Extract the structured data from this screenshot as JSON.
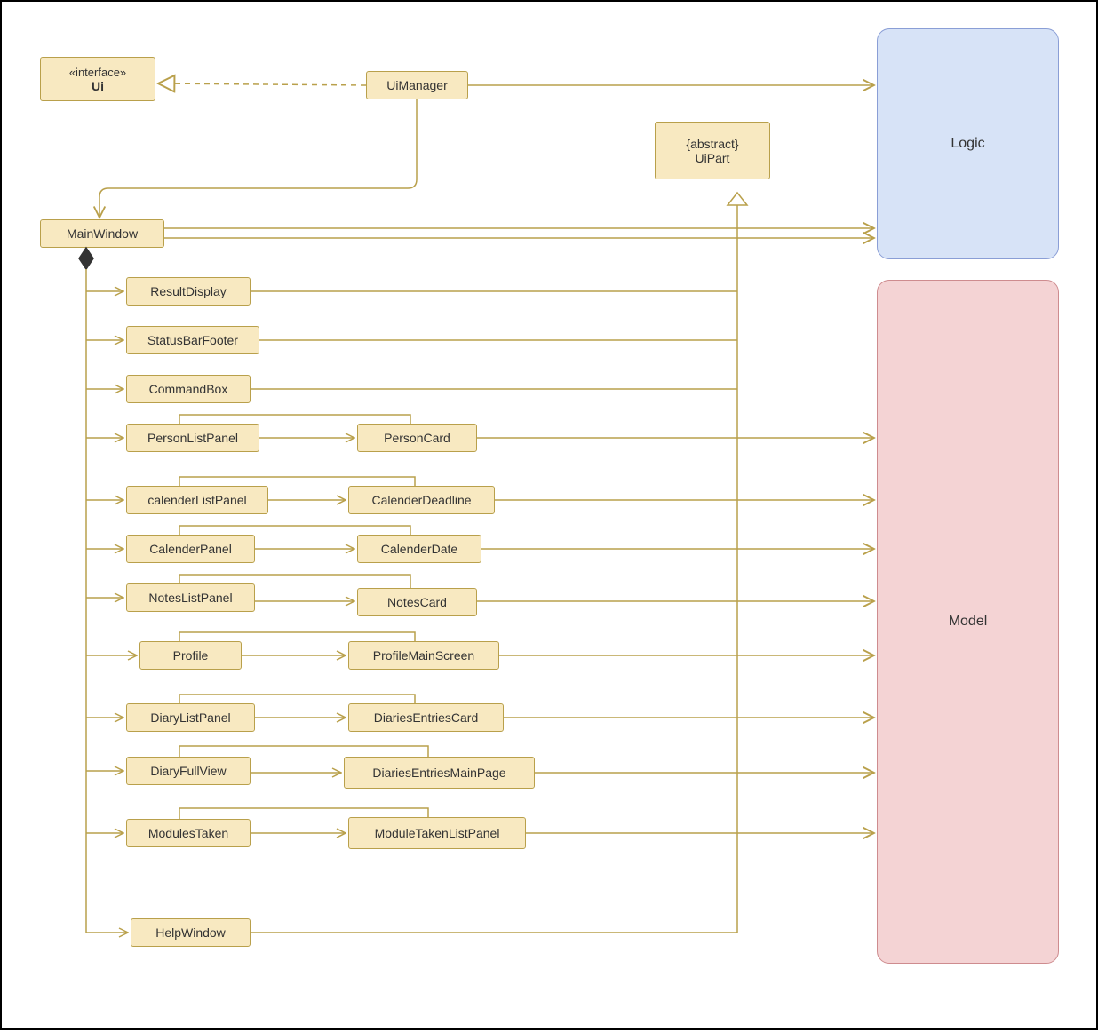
{
  "interface": {
    "stereo": "«interface»",
    "name": "Ui"
  },
  "uimanager": "UiManager",
  "uipart": {
    "constraint": "{abstract}",
    "name": "UiPart"
  },
  "logic": "Logic",
  "model": "Model",
  "mainwindow": "MainWindow",
  "resultdisplay": "ResultDisplay",
  "statusbarfooter": "StatusBarFooter",
  "commandbox": "CommandBox",
  "personlistpanel": "PersonListPanel",
  "personcard": "PersonCard",
  "calenderlistpanel": "calenderListPanel",
  "calenderdeadline": "CalenderDeadline",
  "calenderpanel": "CalenderPanel",
  "calenderdate": "CalenderDate",
  "noteslistpanel": "NotesListPanel",
  "notescard": "NotesCard",
  "profile": "Profile",
  "profilemainscreen": "ProfileMainScreen",
  "diarylistpanel": "DiaryListPanel",
  "diariesentriescard": "DiariesEntriesCard",
  "diaryfullview": "DiaryFullView",
  "diariesentriesmainpage": "DiariesEntriesMainPage",
  "modulestaken": "ModulesTaken",
  "moduletakenlistpanel": "ModuleTakenListPanel",
  "helpwindow": "HelpWindow",
  "colors": {
    "line": "#B9A04B",
    "line2": "#8A9ED6",
    "line3": "#CE8C8F"
  }
}
